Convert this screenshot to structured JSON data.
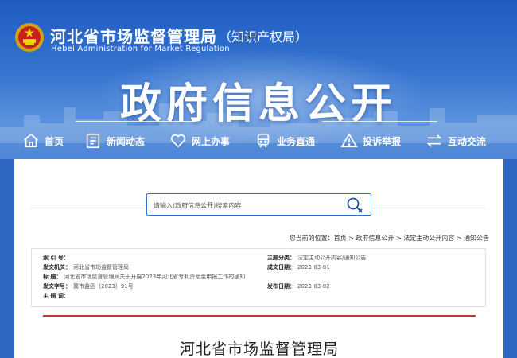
{
  "header": {
    "agency_cn": "河北省市场监督管理局",
    "agency_sub": "（知识产权局）",
    "agency_en": "Hebei  Administration  for  Market  Regulation",
    "big_title": "政府信息公开"
  },
  "nav": {
    "items": [
      {
        "label": "首页",
        "icon": "home-icon"
      },
      {
        "label": "新闻动态",
        "icon": "news-icon"
      },
      {
        "label": "网上办事",
        "icon": "heart-icon"
      },
      {
        "label": "业务直通",
        "icon": "train-icon"
      },
      {
        "label": "投诉举报",
        "icon": "warning-icon"
      },
      {
        "label": "互动交流",
        "icon": "exchange-icon"
      }
    ]
  },
  "search": {
    "placeholder": "请输入(政府信息公开)搜索内容"
  },
  "breadcrumb": {
    "prefix": "您当前的位置：",
    "items": [
      "首页",
      "政府信息公开",
      "法定主动公开内容",
      "通知公告"
    ],
    "sep": " > "
  },
  "meta": {
    "index_label": "索  引  号：",
    "index_value": "",
    "topic_label": "主题分类：",
    "topic_value": "法定主动公开内容/通知公告",
    "issuer_label": "发文机关：",
    "issuer_value": "河北省市场监督管理局",
    "created_label": "成文日期：",
    "created_value": "2023-03-01",
    "title_label": "标      题：",
    "title_value": "河北省市场监督管理局关于开展2023年河北省专利资助金申报工作的通知",
    "docno_label": "发文字号：",
    "docno_value": "冀市监函〔2023〕91号",
    "pubdate_label": "发布日期：",
    "pubdate_value": "2023-03-02",
    "keywords_label": "主  题  词：",
    "keywords_value": ""
  },
  "document": {
    "heading": "河北省市场监督管理局"
  },
  "colors": {
    "brand_blue": "#2f68c4",
    "accent_red": "#c0392b"
  }
}
